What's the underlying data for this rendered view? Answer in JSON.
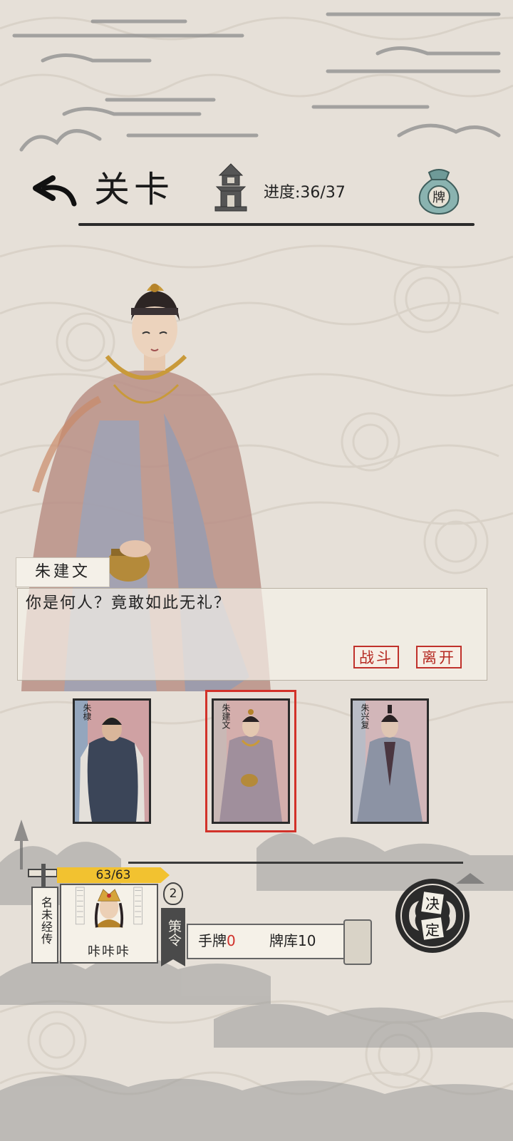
{
  "header": {
    "title": "关卡",
    "progress_label": "进度:",
    "progress_value": "36/37",
    "bag_icon_char": "牌"
  },
  "dialog": {
    "speaker": "朱建文",
    "text": "你是何人？竟敢如此无礼？",
    "fight_button": "战斗",
    "leave_button": "离开"
  },
  "cards": [
    {
      "name": "朱棣",
      "selected": false
    },
    {
      "name": "朱建文",
      "selected": true
    },
    {
      "name": "朱兴复",
      "selected": false
    }
  ],
  "player": {
    "hp": "63/63",
    "name": "咔咔咔",
    "legend_tag": "名未经传",
    "level": "2",
    "strategy_tag": "策令",
    "hand_label": "手牌",
    "hand_count": "0",
    "deck_label": "牌库",
    "deck_count": "10",
    "decide_label_top": "决",
    "decide_label_bottom": "定"
  },
  "colors": {
    "background": "#e6e0d8",
    "accent_red": "#c0312b",
    "hp_yellow": "#f2c230",
    "ink": "#2b2b2b"
  }
}
